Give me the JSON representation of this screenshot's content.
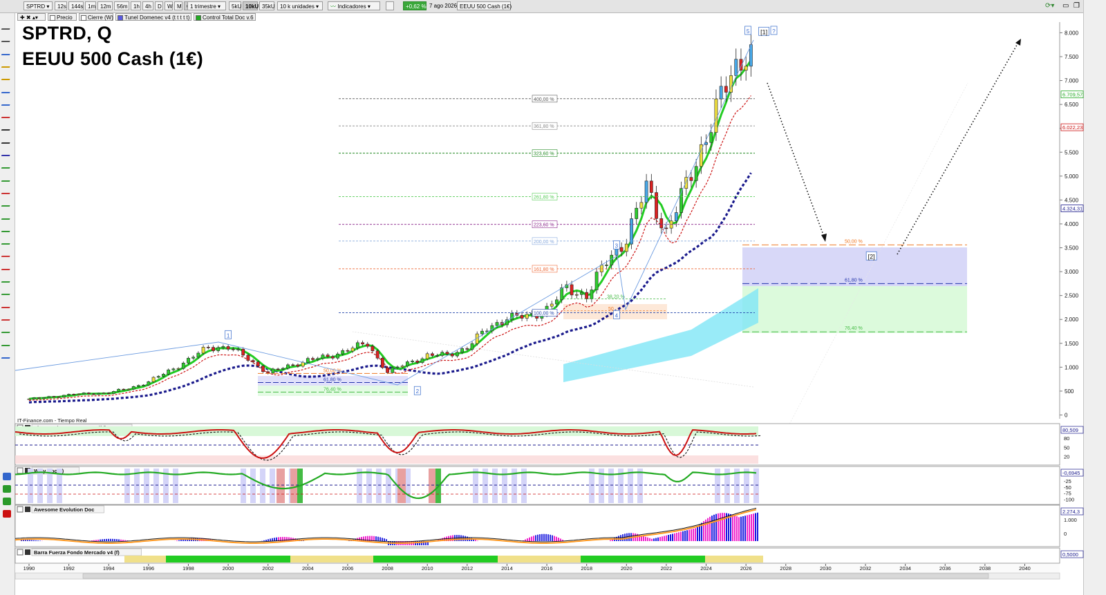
{
  "toolbar": {
    "symbol": "SPTRD",
    "timeframes": [
      "12s",
      "144s",
      "1m",
      "12m",
      "56m",
      "1h",
      "4h",
      "D",
      "W",
      "M",
      "Q"
    ],
    "period": "1 trimestre",
    "units": [
      "5kU",
      "10kU",
      "35kU"
    ],
    "units_select": "10 k unidades",
    "indicators": "Indicadores",
    "change_pct": "+0,62 %",
    "date": "7 ago 2026",
    "instrument": "EEUU 500 Cash (1€)"
  },
  "legend_tags": [
    "Precio",
    "Cierre (W)",
    "Tunel Domenec v4 (t t t t t)",
    "Control Total Doc v.6"
  ],
  "title": {
    "line1": "SPTRD, Q",
    "line2": "EEUU 500 Cash (1€)"
  },
  "source_label": "IT-Finance.com - Tiempo Real",
  "colors": {
    "green_line": "#22cc22",
    "navy_dotted": "#1a1a8c",
    "red_dashed": "#cc1111",
    "bull": "#2ecc2e",
    "bear": "#dd2222",
    "blue_fill": "#d8d8f8",
    "green_fill": "#dcfadc",
    "cyan_band": "#7fe6f6"
  },
  "chart_data": {
    "type": "candlestick",
    "title": "SPTRD, Q",
    "subtitle": "EEUU 500 Cash (1€)",
    "x_ticks": [
      "1990",
      "1992",
      "1994",
      "1996",
      "1998",
      "2000",
      "2002",
      "2004",
      "2006",
      "2008",
      "2010",
      "2012",
      "2014",
      "2016",
      "2018",
      "2020",
      "2022",
      "2024",
      "2026",
      "2028",
      "2030",
      "2032",
      "2034",
      "2036",
      "2038",
      "2040"
    ],
    "y_ticks": [
      "8.000",
      "7.500",
      "7.000",
      "6.500",
      "6.000",
      "5.500",
      "5.000",
      "4.500",
      "4.000",
      "3.500",
      "3.000",
      "2.500",
      "2.000",
      "1.500",
      "1.000",
      "500",
      "0"
    ],
    "ylim": [
      0,
      8100
    ],
    "xlim": [
      1989.5,
      2041
    ],
    "price_labels": [
      {
        "text": "6.709,57",
        "value": 6709.57,
        "color": "#22aa22"
      },
      {
        "text": "6.022,23",
        "value": 6022.23,
        "color": "#cc1111"
      },
      {
        "text": "4.324,31",
        "value": 4324.31,
        "color": "#1a1a8c"
      }
    ],
    "wave_labels": [
      {
        "text": "1",
        "x": 2000.0,
        "y": 1680
      },
      {
        "text": "2",
        "x": 2009.5,
        "y": 510
      },
      {
        "text": "3",
        "x": 2019.5,
        "y": 3560
      },
      {
        "text": "4",
        "x": 2019.5,
        "y": 2100
      },
      {
        "text": "5",
        "x": 2026.1,
        "y": 8050
      },
      {
        "text": "[1]",
        "x": 2026.9,
        "y": 8030
      },
      {
        "text": "?",
        "x": 2027.4,
        "y": 8050
      },
      {
        "text": "[2]",
        "x": 2032.3,
        "y": 3330
      }
    ],
    "fib_extensions": [
      {
        "label": "400,00 %",
        "value": 6620,
        "color": "#555555"
      },
      {
        "label": "361,80 %",
        "value": 6050,
        "color": "#888888"
      },
      {
        "label": "323,60 %",
        "value": 5480,
        "color": "#228822"
      },
      {
        "label": "261,80 %",
        "value": 4570,
        "color": "#55cc55"
      },
      {
        "label": "223,60 %",
        "value": 3990,
        "color": "#882288"
      },
      {
        "label": "200,00 %",
        "value": 3640,
        "color": "#88aadd"
      },
      {
        "label": "161,80 %",
        "value": 3060,
        "color": "#ee6633"
      },
      {
        "label": "100,00 %",
        "value": 2140,
        "color": "#2244aa"
      }
    ],
    "fib_retracements": [
      {
        "label": "50,00 %",
        "value": 3560,
        "color": "#ee7722"
      },
      {
        "label": "61,80 %",
        "value": 2750,
        "color": "#2233aa"
      },
      {
        "label": "76,40 %",
        "value": 1740,
        "color": "#44bb44"
      }
    ],
    "small_fib_2008": [
      {
        "label": "50,00 %",
        "value": 870,
        "color": "#ee7722"
      },
      {
        "label": "61,80 %",
        "value": 680,
        "color": "#2233aa"
      },
      {
        "label": "76,40 %",
        "value": 480,
        "color": "#44bb44"
      }
    ],
    "small_fib_2020": [
      {
        "label": "38,20 %",
        "value": 2430,
        "color": "#44bb44"
      },
      {
        "label": "50",
        "value": 2180,
        "color": "#ee7722"
      }
    ],
    "quarterly_close": [
      {
        "x": 1990,
        "close": 330
      },
      {
        "x": 1991,
        "close": 380
      },
      {
        "x": 1992,
        "close": 420
      },
      {
        "x": 1993,
        "close": 450
      },
      {
        "x": 1994,
        "close": 460
      },
      {
        "x": 1995,
        "close": 560
      },
      {
        "x": 1996,
        "close": 690
      },
      {
        "x": 1997,
        "close": 920
      },
      {
        "x": 1998,
        "close": 1150
      },
      {
        "x": 1999,
        "close": 1420
      },
      {
        "x": 2000,
        "close": 1420
      },
      {
        "x": 2001,
        "close": 1180
      },
      {
        "x": 2002,
        "close": 880
      },
      {
        "x": 2003,
        "close": 1020
      },
      {
        "x": 2004,
        "close": 1150
      },
      {
        "x": 2005,
        "close": 1210
      },
      {
        "x": 2006,
        "close": 1380
      },
      {
        "x": 2007,
        "close": 1480
      },
      {
        "x": 2008,
        "close": 900
      },
      {
        "x": 2009,
        "close": 1080
      },
      {
        "x": 2010,
        "close": 1250
      },
      {
        "x": 2011,
        "close": 1250
      },
      {
        "x": 2012,
        "close": 1420
      },
      {
        "x": 2013,
        "close": 1800
      },
      {
        "x": 2014,
        "close": 2050
      },
      {
        "x": 2015,
        "close": 2040
      },
      {
        "x": 2016,
        "close": 2230
      },
      {
        "x": 2017,
        "close": 2640
      },
      {
        "x": 2018,
        "close": 2510
      },
      {
        "x": 2019,
        "close": 3200
      },
      {
        "x": 2020,
        "close": 3720
      },
      {
        "x": 2021,
        "close": 4750
      },
      {
        "x": 2022,
        "close": 3850
      },
      {
        "x": 2023,
        "close": 4770
      },
      {
        "x": 2024,
        "close": 5880
      },
      {
        "x": 2025,
        "close": 6845
      },
      {
        "x": 2026,
        "close": 7750
      }
    ],
    "indicator_panels": [
      {
        "name": "Sistema de trenes Doc v4 (f f)",
        "value": "80,509",
        "ticks": [
          "80",
          "50",
          "20"
        ]
      },
      {
        "name": "Willy Doc (t)",
        "value": "-0,6945",
        "ticks": [
          "-25",
          "-50",
          "-75",
          "-100"
        ]
      },
      {
        "name": "Awesome Evolution Doc",
        "value": "2.274,3",
        "ticks": [
          "1.000",
          "0"
        ]
      },
      {
        "name": "Barra Fuerza Fondo Mercado v4 (f)",
        "value": "0,5000",
        "ticks": []
      }
    ]
  }
}
